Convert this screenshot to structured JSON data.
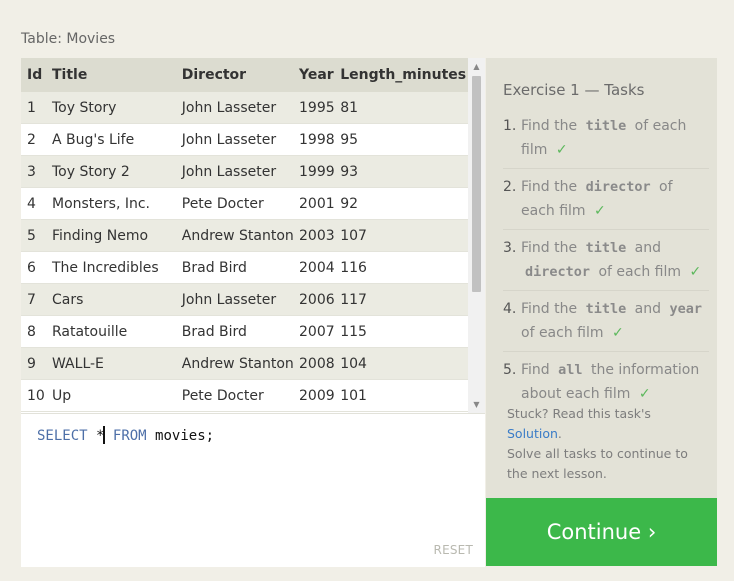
{
  "table_caption": "Table: Movies",
  "table": {
    "columns": [
      "Id",
      "Title",
      "Director",
      "Year",
      "Length_minutes"
    ],
    "rows": [
      [
        "1",
        "Toy Story",
        "John Lasseter",
        "1995",
        "81"
      ],
      [
        "2",
        "A Bug's Life",
        "John Lasseter",
        "1998",
        "95"
      ],
      [
        "3",
        "Toy Story 2",
        "John Lasseter",
        "1999",
        "93"
      ],
      [
        "4",
        "Monsters, Inc.",
        "Pete Docter",
        "2001",
        "92"
      ],
      [
        "5",
        "Finding Nemo",
        "Andrew Stanton",
        "2003",
        "107"
      ],
      [
        "6",
        "The Incredibles",
        "Brad Bird",
        "2004",
        "116"
      ],
      [
        "7",
        "Cars",
        "John Lasseter",
        "2006",
        "117"
      ],
      [
        "8",
        "Ratatouille",
        "Brad Bird",
        "2007",
        "115"
      ],
      [
        "9",
        "WALL-E",
        "Andrew Stanton",
        "2008",
        "104"
      ],
      [
        "10",
        "Up",
        "Pete Docter",
        "2009",
        "101"
      ]
    ]
  },
  "editor": {
    "kw_select": "SELECT",
    "star": "*",
    "kw_from": "FROM",
    "rest": "movies;",
    "reset_label": "RESET"
  },
  "exercise": {
    "title": "Exercise 1 — Tasks",
    "check": "✓",
    "tasks": [
      {
        "num": "1.",
        "pre": "Find the",
        "code": "title",
        "post": "of each film"
      },
      {
        "num": "2.",
        "pre": "Find the",
        "code": "director",
        "post": "of each film"
      },
      {
        "num": "3.",
        "pre": "Find the",
        "code": "title",
        "mid": "and",
        "code2": "director",
        "post": "of each film"
      },
      {
        "num": "4.",
        "pre": "Find the",
        "code": "title",
        "mid": "and",
        "code2": "year",
        "post": "of each film"
      },
      {
        "num": "5.",
        "pre": "Find",
        "code": "all",
        "post": "the information about each film"
      }
    ]
  },
  "help": {
    "stuck": "Stuck? Read this task's",
    "solution_link": "Solution",
    "period": ".",
    "solve_all": "Solve all tasks to continue to the next lesson."
  },
  "continue_label": "Continue ›",
  "colors": {
    "background": "#f1efe7",
    "header_row": "#dcdcd0",
    "stripe": "#ebebe2",
    "task_panel": "#e3e2d7",
    "continue_button": "#3cb84a",
    "check": "#5cb85c",
    "sql_keyword": "#4d6fa8",
    "link": "#3a7cc7"
  }
}
